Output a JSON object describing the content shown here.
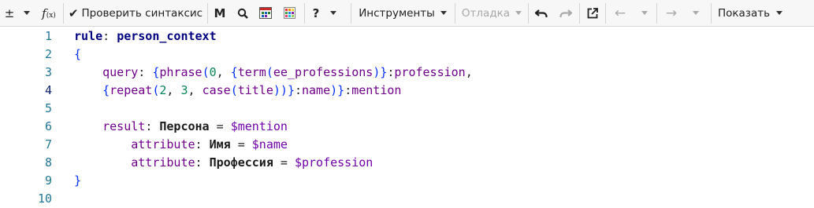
{
  "toolbar": {
    "plusminus": "±",
    "fx": "f",
    "fx_sub": "(x)",
    "check_syntax": "Проверить синтаксис",
    "m_label": "M",
    "help": "?",
    "tools": "Инструменты",
    "debug": "Отладка",
    "show": "Показать"
  },
  "editor": {
    "lines": [
      {
        "n": "1"
      },
      {
        "n": "2"
      },
      {
        "n": "3"
      },
      {
        "n": "4"
      },
      {
        "n": "5"
      },
      {
        "n": "6"
      },
      {
        "n": "7"
      },
      {
        "n": "8"
      },
      {
        "n": "9"
      },
      {
        "n": "10"
      }
    ],
    "code": {
      "l1_kw": "rule",
      "l1_colon": ": ",
      "l1_name": "person_context",
      "l2": "{",
      "l3_indent": "    ",
      "l3_query": "query",
      "l3_colon": ": ",
      "l3_brace1": "{",
      "l3_phrase": "phrase",
      "l3_p1": "(",
      "l3_zero": "0",
      "l3_comma": ", ",
      "l3_brace2": "{",
      "l3_term": "term",
      "l3_p2": "(",
      "l3_ee": "ee_professions",
      "l3_p3": ")",
      "l3_brace3": "}",
      "l3_colon2": ":",
      "l3_prof": "profession",
      "l3_end": ",",
      "l4_indent": "    ",
      "l4_brace1": "{",
      "l4_repeat": "repeat",
      "l4_p1": "(",
      "l4_two": "2",
      "l4_c1": ", ",
      "l4_three": "3",
      "l4_c2": ", ",
      "l4_case": "case",
      "l4_p2": "(",
      "l4_title": "title",
      "l4_p3": "))",
      "l4_brace2": "}",
      "l4_colon": ":",
      "l4_name": "name",
      "l4_p4": ")",
      "l4_brace3": "}",
      "l4_colon2": ":",
      "l4_mention": "mention",
      "l6_indent": "    ",
      "l6_result": "result",
      "l6_colon": ": ",
      "l6_person": "Персона",
      "l6_eq": " = ",
      "l6_var": "$mention",
      "l7_indent": "        ",
      "l7_attr": "attribute",
      "l7_colon": ": ",
      "l7_name": "Имя",
      "l7_eq": " = ",
      "l7_var": "$name",
      "l8_indent": "        ",
      "l8_attr": "attribute",
      "l8_colon": ": ",
      "l8_name": "Профессия",
      "l8_eq": " = ",
      "l8_var": "$profession",
      "l9": "}"
    }
  }
}
